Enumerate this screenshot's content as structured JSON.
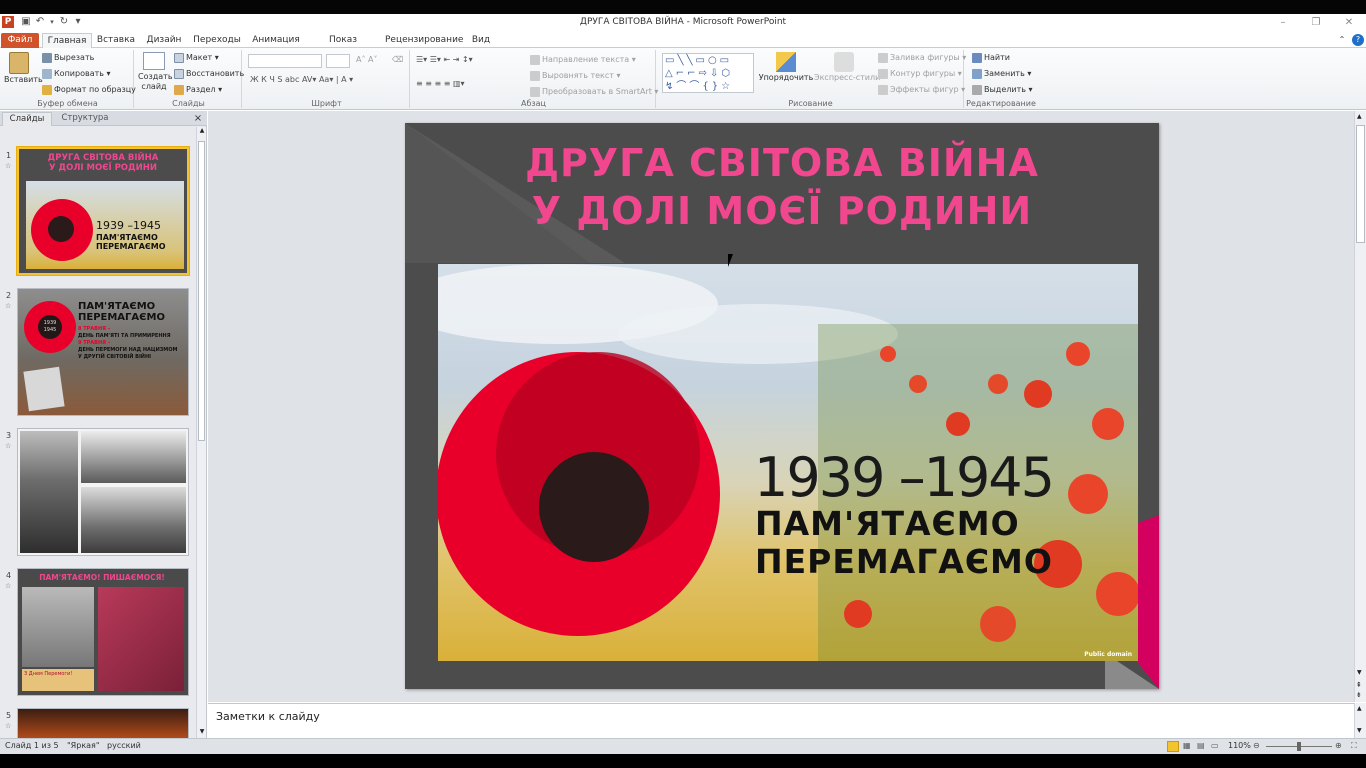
{
  "window": {
    "title": "ДРУГА СВІТОВА ВІЙНА  -  Microsoft PowerPoint",
    "app_icon": "P"
  },
  "tabs": [
    {
      "label": "Файл"
    },
    {
      "label": "Главная"
    },
    {
      "label": "Вставка"
    },
    {
      "label": "Дизайн"
    },
    {
      "label": "Переходы"
    },
    {
      "label": "Анимация"
    },
    {
      "label": "Показ слайдов"
    },
    {
      "label": "Рецензирование"
    },
    {
      "label": "Вид"
    }
  ],
  "ribbon": {
    "clipboard": {
      "paste": "Вставить",
      "cut": "Вырезать",
      "copy": "Копировать",
      "format": "Формат по образцу",
      "label": "Буфер обмена"
    },
    "slides": {
      "new": "Создать слайд",
      "layout": "Макет",
      "reset": "Восстановить",
      "section": "Раздел",
      "label": "Слайды"
    },
    "font": {
      "label": "Шрифт"
    },
    "paragraph": {
      "text_dir": "Направление текста",
      "align_text": "Выровнять текст",
      "smartart": "Преобразовать в SmartArt",
      "label": "Абзац"
    },
    "drawing": {
      "arrange": "Упорядочить",
      "quick_styles": "Экспресс-стили",
      "fill": "Заливка фигуры",
      "outline": "Контур фигуры",
      "effects": "Эффекты фигур",
      "label": "Рисование"
    },
    "editing": {
      "find": "Найти",
      "replace": "Заменить",
      "select": "Выделить",
      "label": "Редактирование"
    }
  },
  "left_panel": {
    "tab_slides": "Слайды",
    "tab_outline": "Структура",
    "close": "×"
  },
  "thumbnails": [
    {
      "num": "1",
      "title1": "ДРУГА  СВІТОВА ВІЙНА",
      "title2": "У ДОЛІ МОЄЇ РОДИНИ",
      "years": "1939 –1945",
      "s1": "ПАМ'ЯТАЄМО",
      "s2": "ПЕРЕМАГАЄМО"
    },
    {
      "num": "2",
      "h1": "ПАМ'ЯТАЄМО",
      "h2": "ПЕРЕМАГАЄМО",
      "d1": "8 ТРАВНЯ –",
      "d2": "ДЕНЬ ПАМ'ЯТІ ТА ПРИМИРЕННЯ",
      "d3": "9 ТРАВНЯ –",
      "d4": "ДЕНЬ ПЕРЕМОГИ НАД НАЦИЗМОМ",
      "d5": "У ДРУГІЙ СВІТОВІЙ ВІЙНІ",
      "circle": "1939 1945"
    },
    {
      "num": "3"
    },
    {
      "num": "4",
      "title": "ПАМ'ЯТАЄМО! ПИШАЄМОСЯ!",
      "badge": "З Днем Перемоги!"
    },
    {
      "num": "5"
    }
  ],
  "slide": {
    "title1": "ДРУГА СВІТОВА ВІЙНА",
    "title2": "У ДОЛІ МОЄЇ РОДИНИ",
    "years": "1939 –1945",
    "slogan1": "ПАМ'ЯТАЄМО",
    "slogan2": "ПЕРЕМАГАЄМО",
    "credit": "Public domain"
  },
  "notes": {
    "placeholder": "Заметки к слайду"
  },
  "status": {
    "slide": "Слайд 1 из 5",
    "theme": "\"Яркая\"",
    "lang": "русский",
    "zoom": "110%"
  },
  "colors": {
    "accent_pink": "#f0478f",
    "file_tab": "#d1532b",
    "poppy_red": "#e8002a",
    "magenta": "#d4005f"
  }
}
